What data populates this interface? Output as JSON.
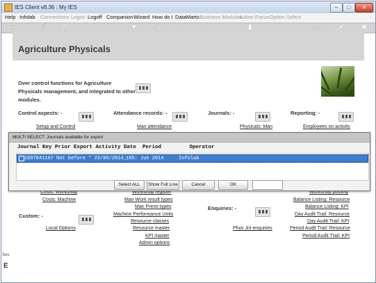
{
  "window": {
    "title": "IES Client v8.36 : My IES",
    "controls": [
      "minimize",
      "maximize",
      "close"
    ]
  },
  "menu": [
    {
      "label": "Help",
      "enabled": true
    },
    {
      "label": "Infolab",
      "enabled": true
    },
    {
      "label": "Connections",
      "enabled": false
    },
    {
      "label": "Logon",
      "enabled": false
    },
    {
      "label": "Logoff",
      "enabled": true
    },
    {
      "label": "Companion",
      "enabled": true
    },
    {
      "label": "Wizard",
      "enabled": true
    },
    {
      "label": "How do I",
      "enabled": true
    },
    {
      "label": "DataMarts",
      "enabled": true
    },
    {
      "label": "Business Modules",
      "enabled": false
    },
    {
      "label": "Action Focus",
      "enabled": false
    },
    {
      "label": "Option Select",
      "enabled": false
    }
  ],
  "toolbar": {
    "icons": [
      "back-key-icon",
      "help-icon",
      "search-icon",
      "heart-icon",
      "clock-icon",
      "rewind-icon",
      "fast-forward-icon",
      "cross-icon",
      "stop-icon",
      "print-icon",
      "ok-icon",
      "close-icon"
    ]
  },
  "page": {
    "title": "Agriculture Physicals",
    "intro": "Over control functions for Agriculture Physicals management, and integrated to other modules."
  },
  "sections": {
    "control_aspects": "Control aspects: -",
    "attendance_records": "Attendance records: -",
    "journals": "Journals: -",
    "reporting": "Reporting: -",
    "custom": "Custom: -",
    "enquiries": "Enquiries: -"
  },
  "links": {
    "setup_and_control": "Setup and Control",
    "man_attendance": "Man attendance",
    "physicals_man": "Physicals: Man",
    "employees_on_activity": "Employees on activity",
    "costs_workshop": "Costs: Workshop",
    "costs_machine": "Costs: Machine",
    "local_options": "Local Options",
    "workshop_register": "Workshop register",
    "man_work_result_types": "Man Work result types",
    "man_premi_types": "Man Premi types",
    "machine_performance_units": "Machine Performance Units",
    "resource_classes": "Resource classes",
    "resource_master": "Resource master",
    "kpi_master": "KPI master",
    "admin_options": "Admin options",
    "phys_jnl_enquiries": "Phys Jnl enquiries",
    "workshop_posting": "Workshop posting",
    "balance_listing_resource": "Balance Listing: Resource",
    "balance_listing_kpi": "Balance Listing: KPI",
    "day_audit_trail_resource": "Day Audit Trail: Resource",
    "day_audit_trail_kpi": "Day Audit Trail: KPI",
    "period_audit_trail_resource": "Period Audit Trail: Resource",
    "period_audit_trail_kpi": "Period Audit Trail: KPI"
  },
  "modal": {
    "title": "MULTI SELECT: Journals available for export",
    "columns": "Journal Key Prior Export Activity Date  Period         Operator",
    "rows": [
      {
        "journal_key": "1697641107",
        "prior_export": "Not before * 23/06/2014_",
        "period": "165: Jun 2014",
        "operator": "Infolab",
        "selected": true
      }
    ],
    "buttons": {
      "select_all": "Select ALL",
      "show_full_line": "Show Full Line",
      "cancel": "Cancel",
      "ok": "OK"
    },
    "field_value": ""
  },
  "side_stub": {
    "text1": "Ses",
    "text2": "E"
  },
  "colors": {
    "header_band": "#d5d5d5",
    "toolbar": "#d3d3d3",
    "selection": "#3d7fcf"
  }
}
